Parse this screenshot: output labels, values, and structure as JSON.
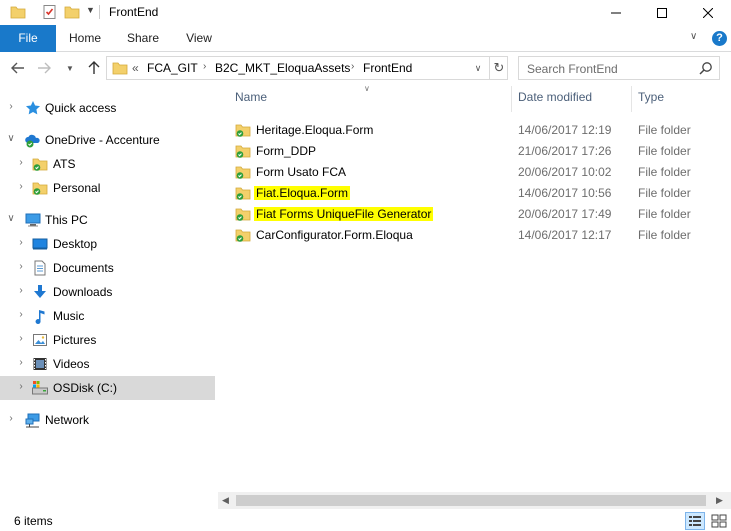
{
  "window": {
    "title": "FrontEnd"
  },
  "ribbon": {
    "tabs": [
      "File",
      "Home",
      "Share",
      "View"
    ],
    "help_label": "?"
  },
  "address": {
    "overflow": "«",
    "crumbs": [
      "FCA_GIT",
      "B2C_MKT_EloquaAssets",
      "FrontEnd"
    ]
  },
  "search": {
    "placeholder": "Search FrontEnd"
  },
  "nav_pane": {
    "items": [
      {
        "label": "Quick access",
        "icon": "star-icon"
      },
      {
        "label": "OneDrive - Accenture",
        "icon": "onedrive-cloud-icon"
      },
      {
        "label": "ATS",
        "icon": "folder-sync-icon"
      },
      {
        "label": "Personal",
        "icon": "folder-sync-icon"
      },
      {
        "label": "This PC",
        "icon": "computer-icon"
      },
      {
        "label": "Desktop",
        "icon": "desktop-icon"
      },
      {
        "label": "Documents",
        "icon": "documents-icon"
      },
      {
        "label": "Downloads",
        "icon": "downloads-icon"
      },
      {
        "label": "Music",
        "icon": "music-icon"
      },
      {
        "label": "Pictures",
        "icon": "pictures-icon"
      },
      {
        "label": "Videos",
        "icon": "videos-icon"
      },
      {
        "label": "OSDisk (C:)",
        "icon": "drive-icon"
      },
      {
        "label": "Network",
        "icon": "network-icon"
      }
    ],
    "selected": "OSDisk (C:)"
  },
  "file_list": {
    "columns": [
      "Name",
      "Date modified",
      "Type"
    ],
    "rows": [
      {
        "name": "Heritage.Eloqua.Form",
        "date": "14/06/2017 12:19",
        "type": "File folder",
        "highlight": false
      },
      {
        "name": "Form_DDP",
        "date": "21/06/2017 17:26",
        "type": "File folder",
        "highlight": false
      },
      {
        "name": "Form Usato FCA",
        "date": "20/06/2017 10:02",
        "type": "File folder",
        "highlight": false
      },
      {
        "name": "Fiat.Eloqua.Form",
        "date": "14/06/2017 10:56",
        "type": "File folder",
        "highlight": true
      },
      {
        "name": "Fiat Forms UniqueFile Generator",
        "date": "20/06/2017 17:49",
        "type": "File folder",
        "highlight": true
      },
      {
        "name": "CarConfigurator.Form.Eloqua",
        "date": "14/06/2017 12:17",
        "type": "File folder",
        "highlight": false
      }
    ]
  },
  "status": {
    "item_count": "6 items"
  },
  "colors": {
    "file_tab": "#1979ca",
    "highlight": "#ffff00",
    "folder": "#f3d06b",
    "sync_check": "#2e9e3a",
    "selected_nav": "#d9d9d9"
  }
}
